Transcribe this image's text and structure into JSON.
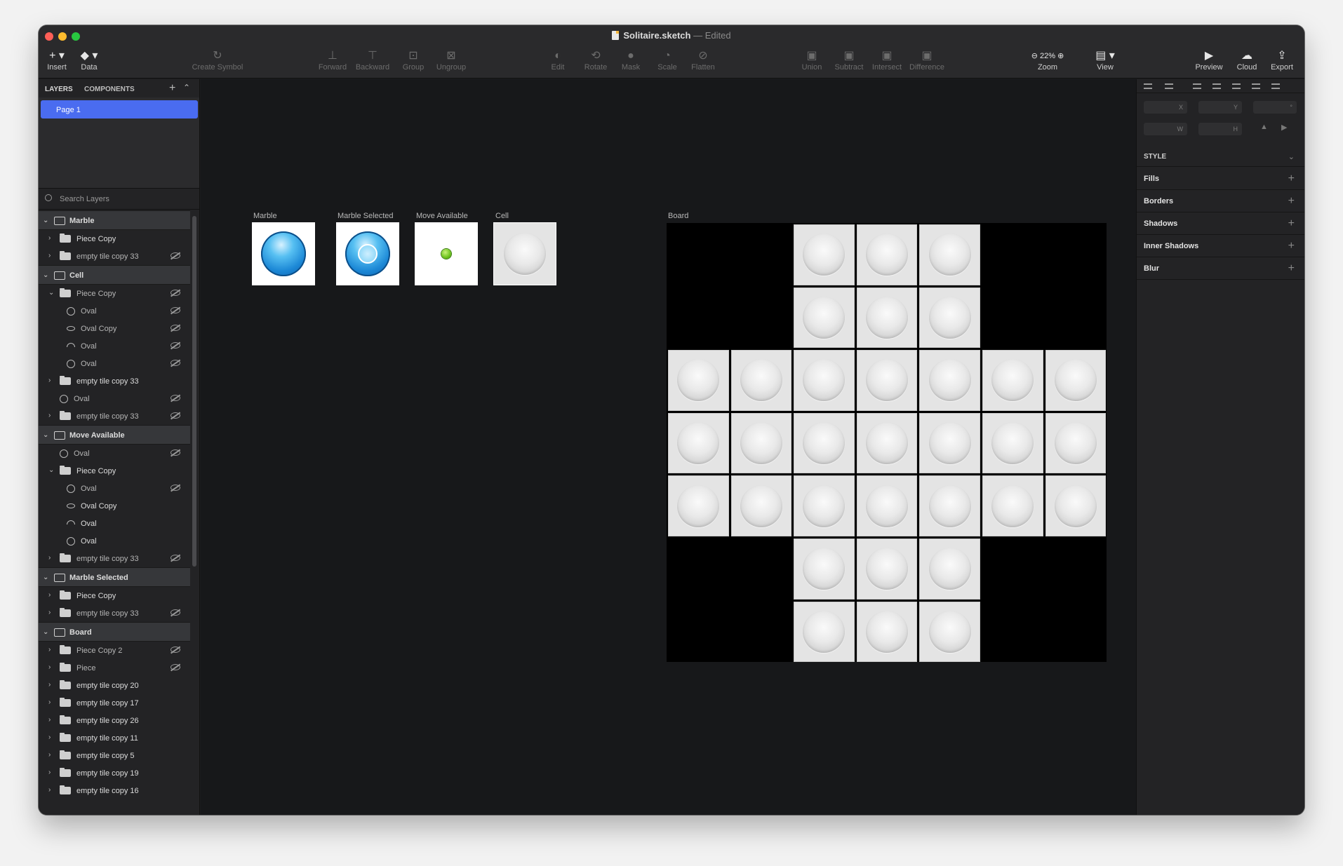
{
  "window": {
    "filename": "Solitaire.sketch",
    "separator": "—",
    "status": "Edited"
  },
  "toolbar": {
    "insert": "Insert",
    "data": "Data",
    "create_symbol": "Create Symbol",
    "forward": "Forward",
    "backward": "Backward",
    "group": "Group",
    "ungroup": "Ungroup",
    "edit": "Edit",
    "rotate": "Rotate",
    "mask": "Mask",
    "scale": "Scale",
    "flatten": "Flatten",
    "union": "Union",
    "subtract": "Subtract",
    "intersect": "Intersect",
    "difference": "Difference",
    "zoom_value": "22%",
    "zoom": "Zoom",
    "view": "View",
    "preview": "Preview",
    "cloud": "Cloud",
    "export": "Export"
  },
  "left_panel": {
    "tab_layers": "LAYERS",
    "tab_components": "COMPONENTS",
    "page": "Page 1",
    "search_placeholder": "Search Layers",
    "layers": [
      {
        "type": "artboard",
        "label": "Marble"
      },
      {
        "type": "folder",
        "label": "Piece Copy",
        "indent": 1,
        "chev": ">",
        "hidden": false
      },
      {
        "type": "folder",
        "label": "empty tile copy 33",
        "indent": 1,
        "chev": ">",
        "hidden": true
      },
      {
        "type": "artboard",
        "label": "Cell"
      },
      {
        "type": "folder",
        "label": "Piece Copy",
        "indent": 1,
        "chev": "v",
        "hidden": true
      },
      {
        "type": "oval",
        "label": "Oval",
        "indent": 2,
        "hidden": true
      },
      {
        "type": "ovalflat",
        "label": "Oval Copy",
        "indent": 2,
        "hidden": true
      },
      {
        "type": "ovalhalf",
        "label": "Oval",
        "indent": 2,
        "hidden": true
      },
      {
        "type": "oval",
        "label": "Oval",
        "indent": 2,
        "hidden": true
      },
      {
        "type": "folder",
        "label": "empty tile copy 33",
        "indent": 1,
        "chev": ">",
        "hidden": false
      },
      {
        "type": "oval",
        "label": "Oval",
        "indent": 1,
        "hidden": true
      },
      {
        "type": "folder",
        "label": "empty tile copy 33",
        "indent": 1,
        "chev": ">",
        "hidden": true
      },
      {
        "type": "artboard",
        "label": "Move Available"
      },
      {
        "type": "oval",
        "label": "Oval",
        "indent": 1,
        "hidden": true
      },
      {
        "type": "folder",
        "label": "Piece Copy",
        "indent": 1,
        "chev": "v",
        "hidden": false
      },
      {
        "type": "oval",
        "label": "Oval",
        "indent": 2,
        "hidden": true
      },
      {
        "type": "ovalflat",
        "label": "Oval Copy",
        "indent": 2,
        "hidden": false
      },
      {
        "type": "ovalhalf",
        "label": "Oval",
        "indent": 2,
        "hidden": false
      },
      {
        "type": "oval",
        "label": "Oval",
        "indent": 2,
        "hidden": false
      },
      {
        "type": "folder",
        "label": "empty tile copy 33",
        "indent": 1,
        "chev": ">",
        "hidden": true
      },
      {
        "type": "artboard",
        "label": "Marble Selected"
      },
      {
        "type": "folder",
        "label": "Piece Copy",
        "indent": 1,
        "chev": ">",
        "hidden": false
      },
      {
        "type": "folder",
        "label": "empty tile copy 33",
        "indent": 1,
        "chev": ">",
        "hidden": true
      },
      {
        "type": "artboard",
        "label": "Board"
      },
      {
        "type": "folder",
        "label": "Piece Copy 2",
        "indent": 1,
        "chev": ">",
        "hidden": true
      },
      {
        "type": "folder",
        "label": "Piece",
        "indent": 1,
        "chev": ">",
        "hidden": true
      },
      {
        "type": "folder",
        "label": "empty tile copy 20",
        "indent": 1,
        "chev": ">",
        "hidden": false
      },
      {
        "type": "folder",
        "label": "empty tile copy 17",
        "indent": 1,
        "chev": ">",
        "hidden": false
      },
      {
        "type": "folder",
        "label": "empty tile copy 26",
        "indent": 1,
        "chev": ">",
        "hidden": false
      },
      {
        "type": "folder",
        "label": "empty tile copy 11",
        "indent": 1,
        "chev": ">",
        "hidden": false
      },
      {
        "type": "folder",
        "label": "empty tile copy 5",
        "indent": 1,
        "chev": ">",
        "hidden": false
      },
      {
        "type": "folder",
        "label": "empty tile copy 19",
        "indent": 1,
        "chev": ">",
        "hidden": false
      },
      {
        "type": "folder",
        "label": "empty tile copy 16",
        "indent": 1,
        "chev": ">",
        "hidden": false
      }
    ]
  },
  "canvas": {
    "artboards": {
      "marble": "Marble",
      "marble_selected": "Marble Selected",
      "move_available": "Move Available",
      "cell": "Cell",
      "board": "Board"
    },
    "board_pattern": [
      "..###..",
      "..###..",
      "#######",
      "#######",
      "#######",
      "..###..",
      "..###.."
    ]
  },
  "inspector": {
    "fields": {
      "x": "X",
      "y": "Y",
      "rotation": "°",
      "w": "W",
      "h": "H"
    },
    "style": "STYLE",
    "sections": [
      "Fills",
      "Borders",
      "Shadows",
      "Inner Shadows",
      "Blur"
    ]
  },
  "colors": {
    "accent": "#4a6cf0",
    "marble": "#1c88d6",
    "move_dot": "#6cc21c"
  }
}
